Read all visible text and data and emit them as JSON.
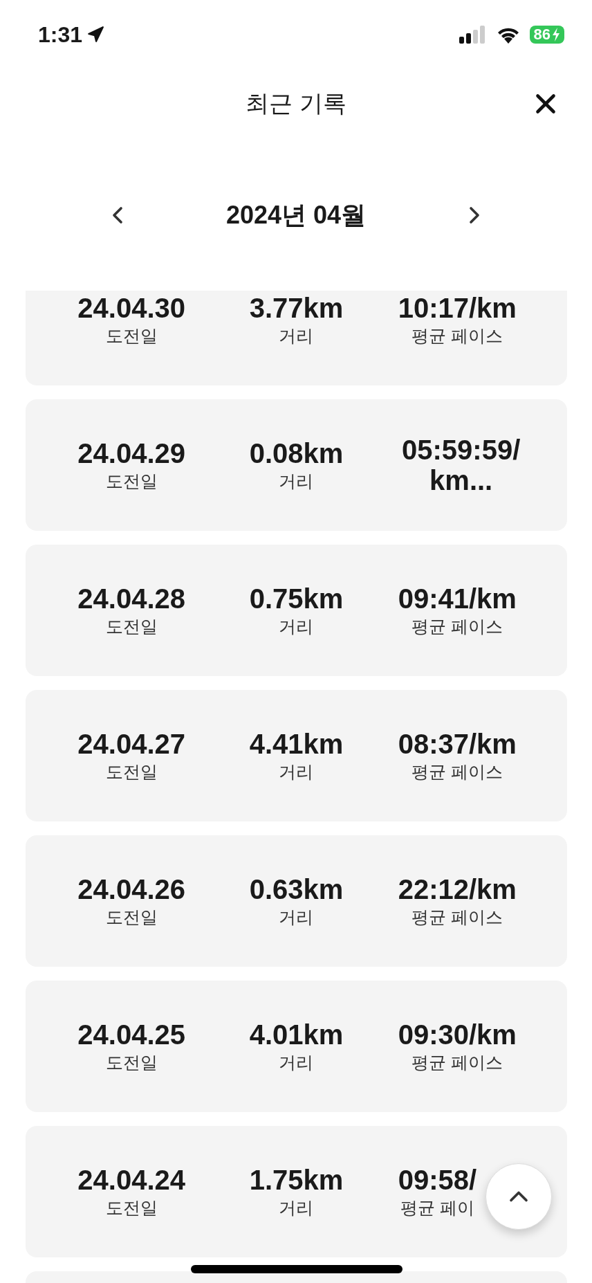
{
  "status_bar": {
    "time": "1:31",
    "battery": "86"
  },
  "header": {
    "title": "최근 기록"
  },
  "month_nav": {
    "label": "2024년 04월"
  },
  "records": [
    {
      "date": "24.04.30",
      "date_label": "도전일",
      "distance": "3.77km",
      "distance_label": "거리",
      "pace": "10:17/km",
      "pace_label": "평균 페이스"
    },
    {
      "date": "24.04.29",
      "date_label": "도전일",
      "distance": "0.08km",
      "distance_label": "거리",
      "pace": "05:59:59/km..."
    },
    {
      "date": "24.04.28",
      "date_label": "도전일",
      "distance": "0.75km",
      "distance_label": "거리",
      "pace": "09:41/km",
      "pace_label": "평균 페이스"
    },
    {
      "date": "24.04.27",
      "date_label": "도전일",
      "distance": "4.41km",
      "distance_label": "거리",
      "pace": "08:37/km",
      "pace_label": "평균 페이스"
    },
    {
      "date": "24.04.26",
      "date_label": "도전일",
      "distance": "0.63km",
      "distance_label": "거리",
      "pace": "22:12/km",
      "pace_label": "평균 페이스"
    },
    {
      "date": "24.04.25",
      "date_label": "도전일",
      "distance": "4.01km",
      "distance_label": "거리",
      "pace": "09:30/km",
      "pace_label": "평균 페이스"
    },
    {
      "date": "24.04.24",
      "date_label": "도전일",
      "distance": "1.75km",
      "distance_label": "거리",
      "pace": "09:58/",
      "pace_label": "평균 페이"
    }
  ]
}
